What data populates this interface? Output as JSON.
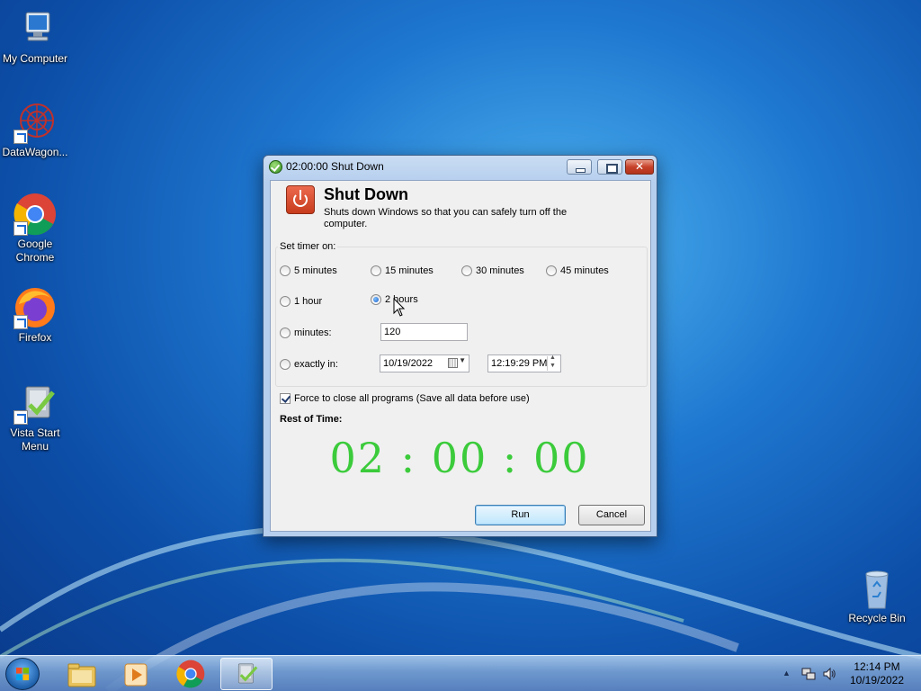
{
  "desktop": {
    "icons": [
      {
        "label": "My Computer"
      },
      {
        "label": "DataWagon..."
      },
      {
        "label": "Google Chrome"
      },
      {
        "label": "Firefox"
      },
      {
        "label": "Vista Start Menu"
      },
      {
        "label": "Recycle Bin"
      }
    ]
  },
  "window": {
    "title": "02:00:00 Shut Down",
    "icon": "green-check-icon",
    "header": {
      "title": "Shut Down",
      "description": "Shuts down Windows so that you can safely turn off the computer."
    },
    "timer_group_label": "Set timer on:",
    "options": {
      "m5": "5 minutes",
      "m15": "15 minutes",
      "m30": "30 minutes",
      "m45": "45 minutes",
      "h1": "1 hour",
      "h2": "2 hours",
      "minutes": "minutes:",
      "exactly": "exactly in:"
    },
    "selected_option": "2 hours",
    "minutes_value": "120",
    "date_value": "10/19/2022",
    "time_value": "12:19:29 PM",
    "force_close_label": "Force to close all programs (Save all data before use)",
    "force_close_checked": true,
    "rest_label": "Rest of Time:",
    "countdown": "02 : 00 : 00",
    "countdown_color": "#3bcb3b",
    "run_label": "Run",
    "cancel_label": "Cancel"
  },
  "taskbar": {
    "items": [
      "start-orb-icon",
      "file-explorer-icon",
      "media-player-icon",
      "chrome-icon",
      "vista-start-menu-icon"
    ],
    "clock_time": "12:14 PM",
    "clock_date": "10/19/2022"
  }
}
